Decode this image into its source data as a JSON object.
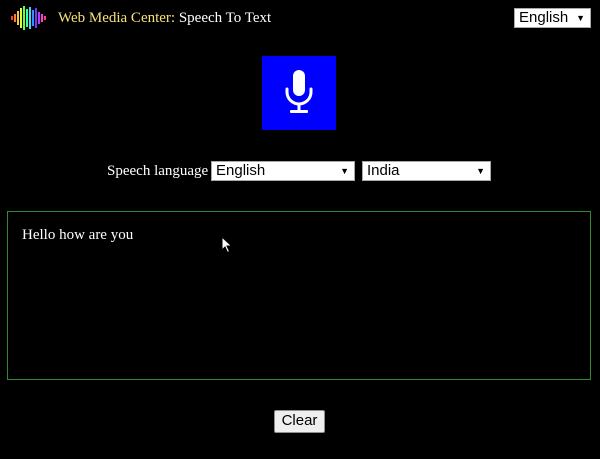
{
  "header": {
    "brand": "Web Media Center",
    "separator": ":",
    "page_title": "Speech To Text",
    "logo_icon": "sound-wave-logo-icon",
    "ui_language": {
      "selected": "English"
    }
  },
  "speech": {
    "mic_icon": "microphone-icon",
    "mic_color": "#0000ff",
    "language_label": "Speech language",
    "language": {
      "selected": "English"
    },
    "region": {
      "selected": "India"
    }
  },
  "transcript": {
    "text": "Hello how are you",
    "border_color": "#2e8b2e"
  },
  "actions": {
    "clear_label": "Clear"
  },
  "colors": {
    "background": "#000000",
    "brand_text": "#f5e27a"
  }
}
